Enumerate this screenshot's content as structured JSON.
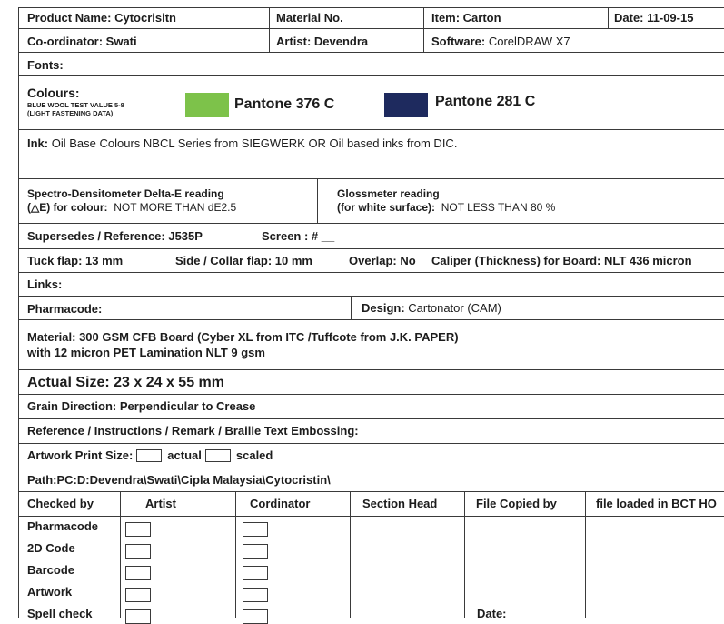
{
  "header": {
    "product_label": "Product  Name: ",
    "product_value": "Cytocrisitn",
    "material_no_label": "Material No.",
    "item_label": "Item: ",
    "item_value": "Carton",
    "date_label": "Date: ",
    "date_value": "11-09-15",
    "coordinator_label": "Co-ordinator: ",
    "coordinator_value": "Swati",
    "artist_label": "Artist: ",
    "artist_value": "Devendra",
    "software_label": "Software: ",
    "software_value": "CorelDRAW X7",
    "fonts_label": "Fonts:"
  },
  "colours": {
    "label": "Colours:",
    "note_line1": "BLUE WOOL TEST VALUE 5-8",
    "note_line2": "(LIGHT FASTENING DATA)",
    "swatches": [
      {
        "name": "Pantone 376 C",
        "color": "#7dc24a"
      },
      {
        "name": "Pantone 281 C",
        "color": "#1e2a5e"
      }
    ]
  },
  "ink": {
    "label": "Ink: ",
    "value": "Oil Base Colours NBCL Series from SIEGWERK OR Oil based inks from DIC."
  },
  "spectro": {
    "line1": "Spectro-Densitometer Delta-E reading",
    "line2_label": "(△E) for colour:",
    "line2_value": "NOT MORE THAN  dE2.5"
  },
  "gloss": {
    "line1": "Glossmeter reading",
    "line2_label": "(for  white surface):",
    "line2_value": "NOT LESS THAN 80 %"
  },
  "supersedes": {
    "text": "Supersedes / Reference: J535P",
    "screen": "Screen : # __"
  },
  "flaps": {
    "tuck": "Tuck flap: 13 mm",
    "side": "Side / Collar flap: 10 mm",
    "overlap": "Overlap: No",
    "caliper": "Caliper (Thickness) for Board: NLT 436  micron"
  },
  "links_label": "Links:",
  "pharmacode_label": "Pharmacode:",
  "design": {
    "label": "Design: ",
    "value": "Cartonator (CAM)"
  },
  "material": {
    "line1": "Material: 300 GSM CFB Board (Cyber XL from ITC /Tuffcote from J.K. PAPER)",
    "line2": "with 12 micron PET Lamination NLT 9 gsm"
  },
  "actual_size": "Actual Size: 23 x 24 x 55 mm",
  "grain": "Grain Direction: Perpendicular to Crease",
  "reference": "Reference / Instructions / Remark / Braille Text Embossing:",
  "artwork_print": {
    "label": "Artwork Print Size:",
    "actual": "actual",
    "scaled": "scaled"
  },
  "path": "Path:PC:D:Devendra\\Swati\\Cipla Malaysia\\Cytocristin\\",
  "checks": {
    "columns": [
      "Checked by",
      "Artist",
      "Cordinator",
      "Section Head",
      "File Copied by",
      "file loaded in BCT HO"
    ],
    "rows": [
      "Pharmacode",
      "2D Code",
      "Barcode",
      "Artwork",
      "Spell check"
    ],
    "date_label": "Date:"
  }
}
